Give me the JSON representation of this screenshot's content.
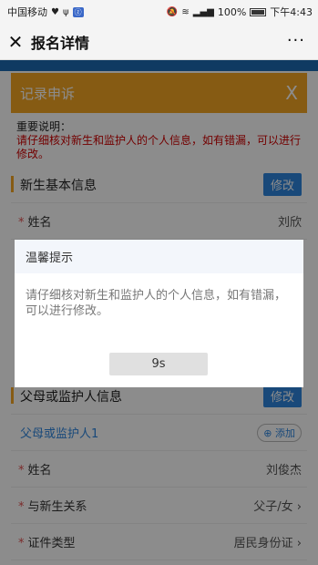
{
  "status": {
    "carrier": "中国移动",
    "battery": "100%",
    "time": "下午4:43"
  },
  "nav": {
    "close_icon": "close-icon",
    "title": "报名详情",
    "more": "···"
  },
  "panel": {
    "title": "记录申诉",
    "close": "X",
    "notice_label": "重要说明：",
    "notice_text": "请仔细核对新生和监护人的个人信息，如有错漏，可以进行修改。",
    "student_section": "新生基本信息",
    "edit_label": "修改",
    "name_label": "姓名",
    "name_value": "刘欣",
    "parent_section": "父母或监护人信息",
    "parent_edit_label": "修改",
    "parent1_label": "父母或监护人1",
    "add_label": "添加",
    "parent_name_label": "姓名",
    "parent_name_value": "刘俊杰",
    "relation_label": "与新生关系",
    "relation_value": "父子/女",
    "id_type_label": "证件类型",
    "id_type_value": "居民身份证"
  },
  "modal": {
    "title": "温馨提示",
    "message": "请仔细核对新生和监护人的个人信息，如有错漏，可以进行修改。",
    "countdown": "9s"
  },
  "colors": {
    "accent": "#f5a623",
    "button_blue": "#2e86de",
    "notice_red": "#d10000"
  }
}
